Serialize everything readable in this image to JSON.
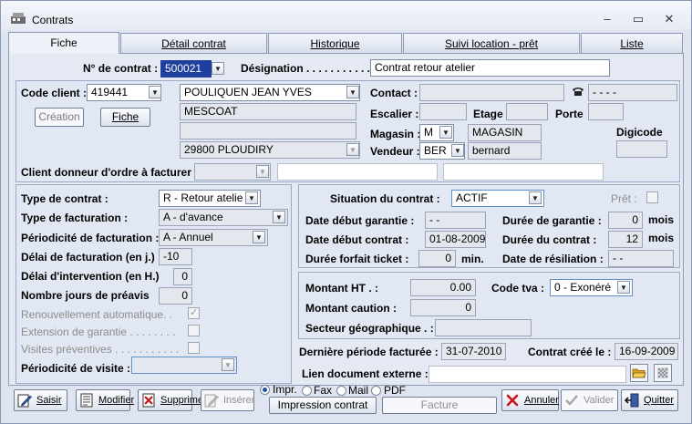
{
  "window": {
    "title": "Contrats",
    "minimize": "–",
    "maximize": "▭",
    "close": "✕"
  },
  "tabs": [
    "Fiche",
    "Détail contrat",
    "Historique",
    "Suivi location - prêt",
    "Liste"
  ],
  "header": {
    "contract_number_label": "N° de contrat :",
    "contract_number": "500021",
    "designation_label": "Désignation . . . . . . . . . . .",
    "designation": "Contrat retour atelier"
  },
  "client": {
    "code_label": "Code client :",
    "code": "419441",
    "name": "POULIQUEN JEAN YVES",
    "address1": "MESCOAT",
    "address2": "",
    "city": "29800 PLOUDIRY",
    "creation_button": "Création",
    "fiche_button": "Fiche",
    "contact_label": "Contact :",
    "contact": "",
    "phone": "- - - -",
    "escalier_label": "Escalier :",
    "etage_label": "Etage",
    "porte_label": "Porte",
    "magasin_label": "Magasin :",
    "magasin_code": "M",
    "magasin_name": "MAGASIN",
    "digicode_label": "Digicode",
    "vendeur_label": "Vendeur :",
    "vendeur_code": "BER",
    "vendeur_name": "bernard",
    "donneur_label": "Client donneur d'ordre à facturer"
  },
  "contract": {
    "type_label": "Type de contrat :",
    "type": "R - Retour atelie",
    "facturation_label": "Type de  facturation :",
    "facturation": "A - d'avance",
    "periodicite_label": "Périodicité de facturation :",
    "periodicite": "A - Annuel",
    "delai_fact_label": "Délai de facturation (en j.)",
    "delai_fact": "-10",
    "delai_int_label": "Délai d'intervention (en H.)",
    "delai_int": "0",
    "preavis_label": "Nombre jours de préavis",
    "preavis": "0",
    "renouvellement_label": "Renouvellement automatique. .",
    "extension_label": "Extension de garantie . . . . . . . .",
    "visites_label": "Visites préventives . . . . . . . . . . .",
    "periodicite_visite_label": "Périodicité de visite :"
  },
  "situation": {
    "label": "Situation du contrat :",
    "value": "ACTIF",
    "pret_label": "Prêt :",
    "debut_garantie_label": "Date début garantie  :",
    "debut_garantie": "- -",
    "duree_garantie_label": "Durée de garantie :",
    "duree_garantie": "0",
    "mois": "mois",
    "debut_contrat_label": "Date début contrat :",
    "debut_contrat": "01-08-2009",
    "duree_contrat_label": "Durée du contrat :",
    "duree_contrat": "12",
    "forfait_label": "Durée forfait ticket  :",
    "forfait": "0",
    "min": "min.",
    "resiliation_label": "Date de résiliation :",
    "resiliation": "- -"
  },
  "montant": {
    "ht_label": "Montant HT . :",
    "ht": "0.00",
    "tva_label": "Code tva :",
    "tva": "0 - Exonéré",
    "caution_label": "Montant caution :",
    "caution": "0",
    "secteur_label": "Secteur géographique . :"
  },
  "footer": {
    "derniere_label": "Dernière période facturée :",
    "derniere": "31-07-2010",
    "cree_label": "Contrat créé le :",
    "cree": "16-09-2009",
    "lien_label": "Lien document  externe :"
  },
  "toolbar": {
    "saisir": "Saisir",
    "modifier": "Modifier",
    "supprimer": "Supprimer",
    "inserer": "Insérer",
    "impr": "Impr.",
    "fax": "Fax",
    "mail": "Mail",
    "pdf": "PDF",
    "impression": "Impression contrat",
    "facture": "Facture",
    "annuler": "Annuler",
    "valider": "Valider",
    "quitter": "Quitter"
  }
}
